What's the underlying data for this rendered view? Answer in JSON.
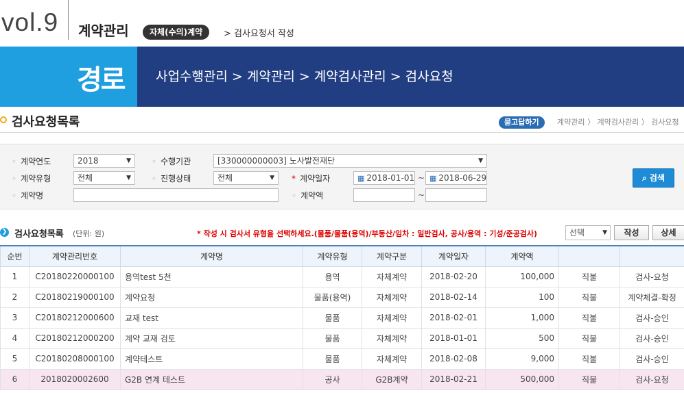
{
  "header": {
    "vol": "vol.9",
    "section": "계약관리",
    "pill": "자체(수의)계약",
    "sub": "> 검사요청서 작성"
  },
  "banner": {
    "label": "경로",
    "path": "사업수행관리 > 계약관리 > 계약검사관리 > 검사요청"
  },
  "page": {
    "title": "검사요청목록",
    "ask_button": "묻고답하기",
    "crumbs": "계약관리 〉 계약검사관리 〉 검사요청"
  },
  "search": {
    "year_label": "계약연도",
    "year_value": "2018",
    "org_label": "수행기관",
    "org_value": "[330000000003] 노사발전재단",
    "type_label": "계약유형",
    "type_value": "전체",
    "status_label": "진행상태",
    "status_value": "전체",
    "date_label": "계약일자",
    "date_from": "2018-01-01",
    "date_to": "2018-06-29",
    "name_label": "계약명",
    "name_value": "",
    "amount_label": "계약액",
    "amount_from": "",
    "amount_to": "",
    "button": "검색"
  },
  "list": {
    "title": "검사요청목록",
    "unit": "(단위: 원)",
    "notice": "* 작성 시 검사서 유형을 선택하세요.(물품/물품(용역)/부동산/임차 : 일반검사, 공사/용역 : 기성/준공검사)",
    "select_value": "선택",
    "write_button": "작성",
    "detail_button": "상세"
  },
  "table": {
    "headers": [
      "순번",
      "계약관리번호",
      "계약명",
      "계약유형",
      "계약구분",
      "계약일자",
      "계약액",
      "",
      ""
    ],
    "rows": [
      [
        "1",
        "C20180220000100",
        "용역test 5천",
        "용역",
        "자체계약",
        "2018-02-20",
        "100,000",
        "직불",
        "검사-요청"
      ],
      [
        "2",
        "C20180219000100",
        "계약요청",
        "물품(용역)",
        "자체계약",
        "2018-02-14",
        "100",
        "직불",
        "계약체결-확정"
      ],
      [
        "3",
        "C20180212000600",
        "교재 test",
        "물품",
        "자체계약",
        "2018-02-01",
        "1,000",
        "직불",
        "검사-승인"
      ],
      [
        "4",
        "C20180212000200",
        "계약 교재 검토",
        "물품",
        "자체계약",
        "2018-01-01",
        "500",
        "직불",
        "검사-승인"
      ],
      [
        "5",
        "C20180208000100",
        "계약테스트",
        "물품",
        "자체계약",
        "2018-02-08",
        "9,000",
        "직불",
        "검사-승인"
      ],
      [
        "6",
        "2018020002600",
        "G2B 연계 테스트",
        "공사",
        "G2B계약",
        "2018-02-21",
        "500,000",
        "직불",
        "검사-요청"
      ]
    ]
  },
  "colors": {
    "banner_dark": "#213e82",
    "banner_light": "#1f9ee0",
    "search_button": "#1e8bd6",
    "notice_red": "#dd0000",
    "highlight_row": "#f7e6ef"
  }
}
